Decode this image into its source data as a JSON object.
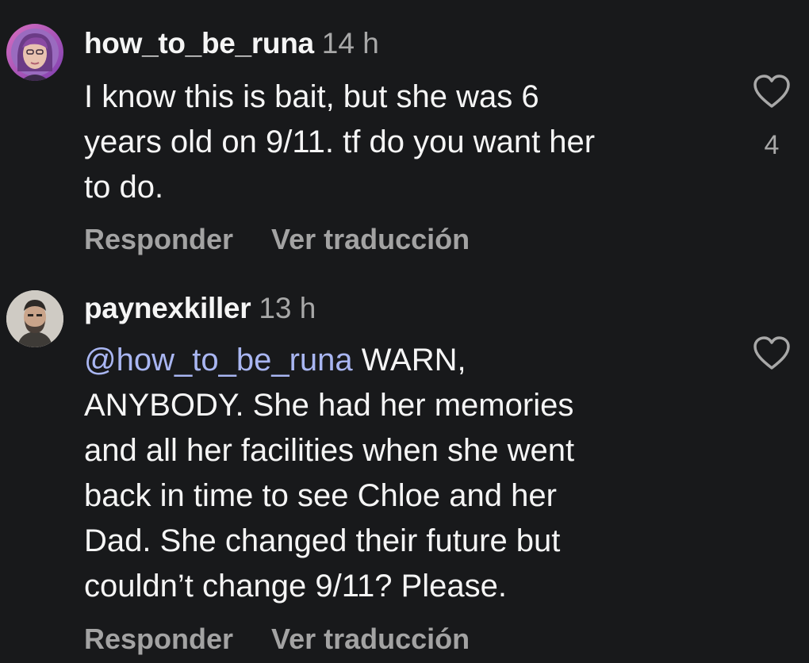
{
  "comments": [
    {
      "username": "how_to_be_runa",
      "time": "14 h",
      "mention": "",
      "lines": [
        "I know this is bait, but she was 6",
        "years old on 9/11. tf do you want her",
        "to do."
      ],
      "reply_label": "Responder",
      "translate_label": "Ver traducción",
      "like_count": "4"
    },
    {
      "username": "paynexkiller",
      "time": "13 h",
      "mention": "@how_to_be_runa",
      "first_line_rest": " WARN,",
      "lines": [
        "ANYBODY. She had her memories",
        "and all her facilities when she went",
        "back in time to see Chloe and her",
        "Dad. She changed their future but",
        "couldn’t change 9/11? Please."
      ],
      "reply_label": "Responder",
      "translate_label": "Ver traducción",
      "like_count": ""
    }
  ],
  "colors": {
    "background": "#18191b",
    "text": "#f5f5f5",
    "secondary": "#a8a8a8",
    "mention": "#a9b6f2"
  },
  "icons": {
    "like": "heart-outline-icon"
  }
}
